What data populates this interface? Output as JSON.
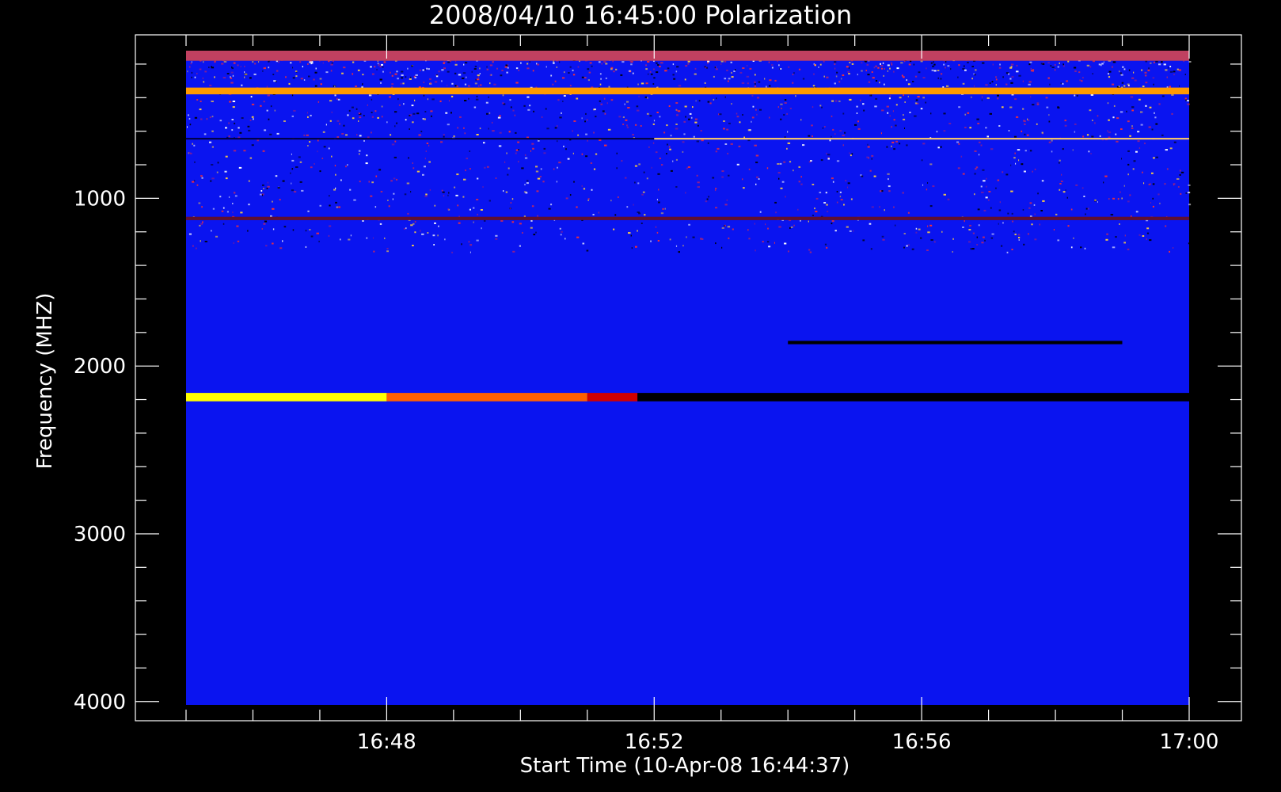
{
  "chart_data": {
    "type": "heatmap",
    "title": "2008/04/10 16:45:00 Polarization",
    "xlabel": "Start Time (10-Apr-08 16:44:37)",
    "ylabel": "Frequency (MHZ)",
    "x_range": [
      "16:45:00",
      "17:00:00"
    ],
    "y_range": [
      120,
      4020
    ],
    "y_reversed": true,
    "x_ticks": [
      "16:48",
      "16:52",
      "16:56",
      "17:00"
    ],
    "y_ticks": [
      1000,
      2000,
      3000,
      4000
    ],
    "colormap": [
      "#000000",
      "#0000ff",
      "#ff0000",
      "#ffff00",
      "#ffffff"
    ],
    "background_color": "#0a14f0",
    "features": [
      {
        "name": "",
        "freq": [
          120,
          180
        ],
        "time": [
          "16:45:00",
          "17:00:00"
        ],
        "color": "#c04060"
      },
      {
        "name": "",
        "freq": [
          340,
          380
        ],
        "time": [
          "16:45:00",
          "17:00:00"
        ],
        "color": "#ff9a00"
      },
      {
        "name": "",
        "freq": [
          640,
          650
        ],
        "time": [
          "16:45:00",
          "16:52:00"
        ],
        "color": "#000040"
      },
      {
        "name": "",
        "freq": [
          640,
          650
        ],
        "time": [
          "16:52:00",
          "17:00:00"
        ],
        "color": "#ffcc66"
      },
      {
        "name": "",
        "freq": [
          1110,
          1130
        ],
        "time": [
          "16:45:00",
          "17:00:00"
        ],
        "color": "#601030"
      },
      {
        "name": "",
        "freq": [
          1850,
          1870
        ],
        "time": [
          "16:54:00",
          "16:59:00"
        ],
        "color": "#000000"
      },
      {
        "name": "",
        "freq": [
          2160,
          2210
        ],
        "time": [
          "16:45:00",
          "16:48:00"
        ],
        "color": "#ffff00"
      },
      {
        "name": "",
        "freq": [
          2160,
          2210
        ],
        "time": [
          "16:48:00",
          "16:51:00"
        ],
        "color": "#ff6000"
      },
      {
        "name": "",
        "freq": [
          2160,
          2210
        ],
        "time": [
          "16:51:00",
          "16:51:45"
        ],
        "color": "#d00000"
      },
      {
        "name": "",
        "freq": [
          2160,
          2210
        ],
        "time": [
          "16:51:45",
          "17:00:00"
        ],
        "color": "#000000"
      }
    ]
  }
}
